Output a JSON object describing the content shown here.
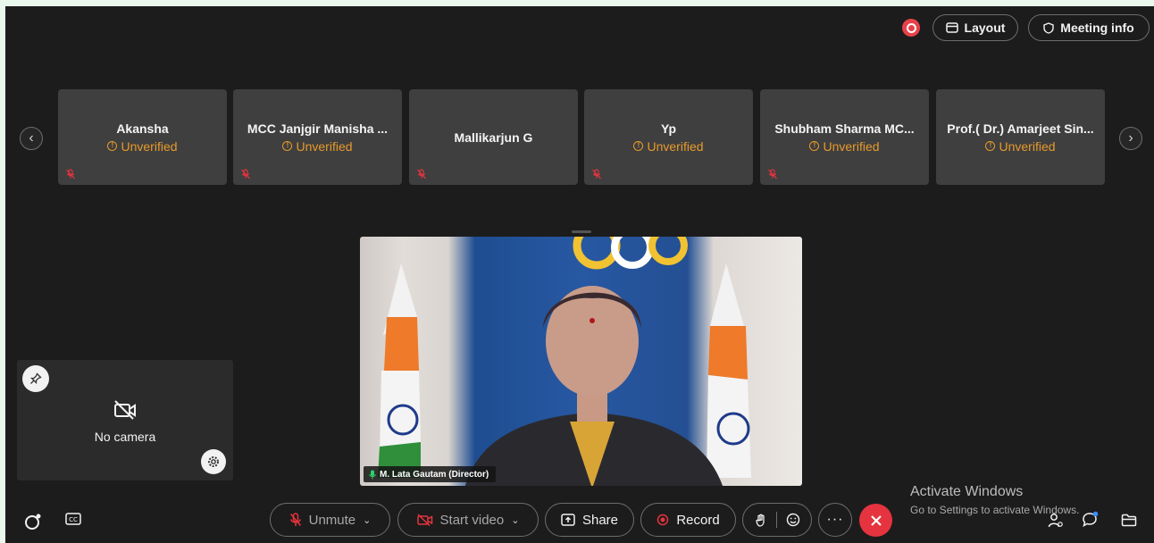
{
  "header": {
    "layout_label": "Layout",
    "meeting_info_label": "Meeting info"
  },
  "participants": [
    {
      "name": "Akansha",
      "status": "Unverified",
      "muted": true
    },
    {
      "name": "MCC Janjgir Manisha ...",
      "status": "Unverified",
      "muted": true
    },
    {
      "name": "Mallikarjun G",
      "status": "",
      "muted": true
    },
    {
      "name": "Yp",
      "status": "Unverified",
      "muted": true
    },
    {
      "name": "Shubham Sharma MC...",
      "status": "Unverified",
      "muted": true
    },
    {
      "name": "Prof.( Dr.) Amarjeet Sin...",
      "status": "Unverified",
      "muted": false
    }
  ],
  "main_video": {
    "speaker_name": "M. Lata Gautam (Director)"
  },
  "self_view": {
    "label": "No camera"
  },
  "controls": {
    "unmute_label": "Unmute",
    "start_video_label": "Start video",
    "share_label": "Share",
    "record_label": "Record"
  },
  "watermark": {
    "title": "Activate Windows",
    "subtitle": "Go to Settings to activate Windows."
  },
  "colors": {
    "background": "#1c1c1c",
    "tile": "#3f3f3f",
    "unverified": "#e89a2b",
    "end_call": "#e5343f",
    "recording": "#e8414a"
  }
}
